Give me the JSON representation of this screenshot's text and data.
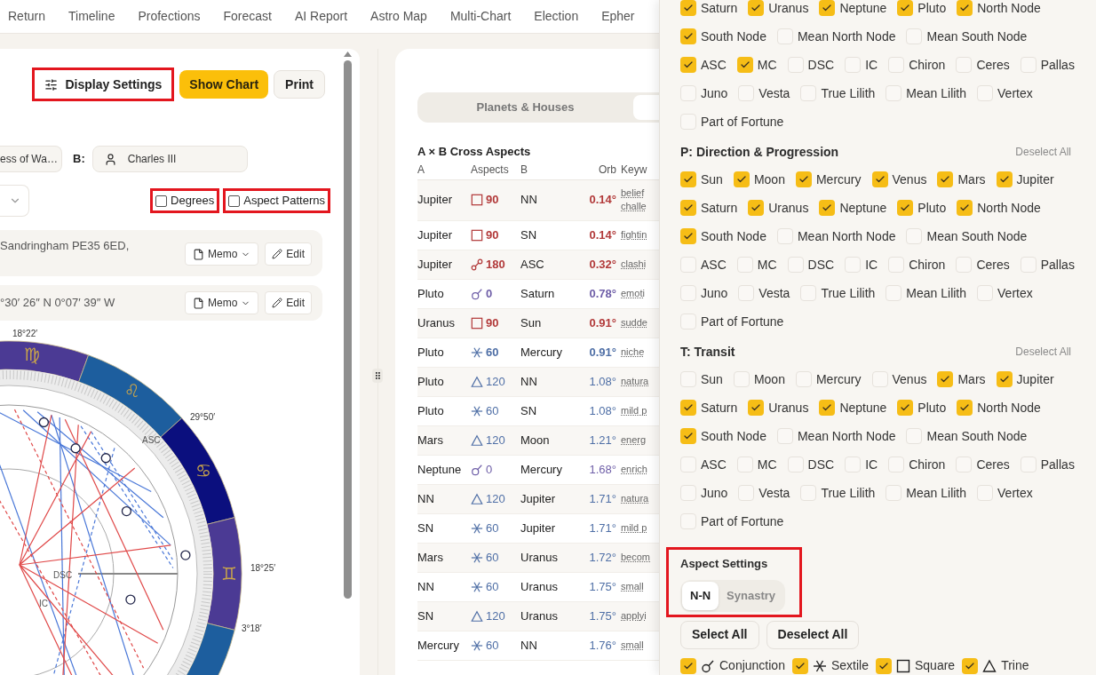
{
  "nav": {
    "tabs": [
      {
        "label": "Return"
      },
      {
        "label": "Timeline"
      },
      {
        "label": "Profections"
      },
      {
        "label": "Forecast"
      },
      {
        "label": "AI Report"
      },
      {
        "label": "Astro Map"
      },
      {
        "label": "Multi-Chart"
      },
      {
        "label": "Election"
      },
      {
        "label": "Epher"
      }
    ]
  },
  "toolbar": {
    "display_settings": {
      "label": "Display Settings",
      "highlighted": true
    },
    "show_chart": "Show Chart",
    "print": "Print"
  },
  "persons": {
    "a_value": "ess of Wa…",
    "b_label": "B:",
    "b_value": "Charles III"
  },
  "options": [
    {
      "label": "Degrees",
      "checked": false,
      "highlighted": true
    },
    {
      "label": "Aspect Patterns",
      "checked": false,
      "highlighted": true
    }
  ],
  "locations": [
    {
      "text": "Sandringham PE35 6ED,",
      "memo": "Memo",
      "edit": "Edit"
    },
    {
      "text": "°30′ 26″ N 0°07′ 39″ W",
      "memo": "Memo",
      "edit": "Edit"
    }
  ],
  "wheel": {
    "signs": [
      {
        "glyph": "♍",
        "color": "#4b3a94"
      },
      {
        "glyph": "♌",
        "color": "#1d5e9e"
      },
      {
        "glyph": "♋",
        "color": "#0b0f7e"
      },
      {
        "glyph": "♊",
        "color": "#4b3a94"
      },
      {
        "color": "#1d5e9e"
      }
    ],
    "degree_labels": [
      "18°22′",
      "29°50′",
      "18°25′",
      "3°18′"
    ],
    "angle_labels": [
      "ASC",
      "DSC",
      "IC"
    ]
  },
  "tabs": [
    {
      "label": "Planets & Houses",
      "selected": false
    },
    {
      "selected": true
    }
  ],
  "cross_aspects": {
    "title": "A × B Cross Aspects",
    "columns": [
      "A",
      "Aspects",
      "B",
      "Orb",
      "Keyw"
    ],
    "rows": [
      {
        "a": "Jupiter",
        "kind": "square",
        "angle": "90",
        "b": "NN",
        "orb": "0.14°",
        "tight": true,
        "keywords": [
          "belief",
          "challe"
        ]
      },
      {
        "a": "Jupiter",
        "kind": "square",
        "angle": "90",
        "b": "SN",
        "orb": "0.14°",
        "tight": true,
        "keywords": [
          "fightin"
        ]
      },
      {
        "a": "Jupiter",
        "kind": "opposition",
        "angle": "180",
        "b": "ASC",
        "orb": "0.32°",
        "tight": true,
        "keywords": [
          "clashi"
        ]
      },
      {
        "a": "Pluto",
        "kind": "conjunction",
        "angle": "0",
        "b": "Saturn",
        "orb": "0.78°",
        "tight": true,
        "keywords": [
          "emoti"
        ]
      },
      {
        "a": "Uranus",
        "kind": "square",
        "angle": "90",
        "b": "Sun",
        "orb": "0.91°",
        "tight": true,
        "keywords": [
          "sudde"
        ]
      },
      {
        "a": "Pluto",
        "kind": "sextile",
        "angle": "60",
        "b": "Mercury",
        "orb": "0.91°",
        "tight": true,
        "keywords": [
          "niche"
        ]
      },
      {
        "a": "Pluto",
        "kind": "trine",
        "angle": "120",
        "b": "NN",
        "orb": "1.08°",
        "tight": false,
        "keywords": [
          "natura"
        ]
      },
      {
        "a": "Pluto",
        "kind": "sextile",
        "angle": "60",
        "b": "SN",
        "orb": "1.08°",
        "tight": false,
        "keywords": [
          "mild p"
        ]
      },
      {
        "a": "Mars",
        "kind": "trine",
        "angle": "120",
        "b": "Moon",
        "orb": "1.21°",
        "tight": false,
        "keywords": [
          "energ"
        ]
      },
      {
        "a": "Neptune",
        "kind": "conjunction",
        "angle": "0",
        "b": "Mercury",
        "orb": "1.68°",
        "tight": false,
        "keywords": [
          "enrich"
        ]
      },
      {
        "a": "NN",
        "kind": "trine",
        "angle": "120",
        "b": "Jupiter",
        "orb": "1.71°",
        "tight": false,
        "keywords": [
          "natura"
        ]
      },
      {
        "a": "SN",
        "kind": "sextile",
        "angle": "60",
        "b": "Jupiter",
        "orb": "1.71°",
        "tight": false,
        "keywords": [
          "mild p"
        ]
      },
      {
        "a": "Mars",
        "kind": "sextile",
        "angle": "60",
        "b": "Uranus",
        "orb": "1.72°",
        "tight": false,
        "keywords": [
          "becom"
        ]
      },
      {
        "a": "NN",
        "kind": "sextile",
        "angle": "60",
        "b": "Uranus",
        "orb": "1.75°",
        "tight": false,
        "keywords": [
          "small"
        ]
      },
      {
        "a": "SN",
        "kind": "trine",
        "angle": "120",
        "b": "Uranus",
        "orb": "1.75°",
        "tight": false,
        "keywords": [
          "applyi"
        ]
      },
      {
        "a": "Mercury",
        "kind": "sextile",
        "angle": "60",
        "b": "NN",
        "orb": "1.76°",
        "tight": false,
        "keywords": [
          "small"
        ]
      }
    ]
  },
  "panel": {
    "sections": [
      {
        "items": [
          {
            "label": "Saturn",
            "checked": true
          },
          {
            "label": "Uranus",
            "checked": true
          },
          {
            "label": "Neptune",
            "checked": true
          },
          {
            "label": "Pluto",
            "checked": true
          },
          {
            "label": "North Node",
            "checked": true
          },
          {
            "label": "South Node",
            "checked": true
          },
          {
            "label": "Mean North Node",
            "checked": false
          },
          {
            "label": "Mean South Node",
            "checked": false
          },
          {
            "label": "ASC",
            "checked": true
          },
          {
            "label": "MC",
            "checked": true
          },
          {
            "label": "DSC",
            "checked": false
          },
          {
            "label": "IC",
            "checked": false
          },
          {
            "label": "Chiron",
            "checked": false
          },
          {
            "label": "Ceres",
            "checked": false
          },
          {
            "label": "Pallas",
            "checked": false
          },
          {
            "label": "Juno",
            "checked": false
          },
          {
            "label": "Vesta",
            "checked": false
          },
          {
            "label": "True Lilith",
            "checked": false
          },
          {
            "label": "Mean Lilith",
            "checked": false
          },
          {
            "label": "Vertex",
            "checked": false
          },
          {
            "label": "Part of Fortune",
            "checked": false
          }
        ]
      },
      {
        "title": "P: Direction & Progression",
        "action": "Deselect All",
        "items": [
          {
            "label": "Sun",
            "checked": true
          },
          {
            "label": "Moon",
            "checked": true
          },
          {
            "label": "Mercury",
            "checked": true
          },
          {
            "label": "Venus",
            "checked": true
          },
          {
            "label": "Mars",
            "checked": true
          },
          {
            "label": "Jupiter",
            "checked": true
          },
          {
            "label": "Saturn",
            "checked": true
          },
          {
            "label": "Uranus",
            "checked": true
          },
          {
            "label": "Neptune",
            "checked": true
          },
          {
            "label": "Pluto",
            "checked": true
          },
          {
            "label": "North Node",
            "checked": true
          },
          {
            "label": "South Node",
            "checked": true
          },
          {
            "label": "Mean North Node",
            "checked": false
          },
          {
            "label": "Mean South Node",
            "checked": false
          },
          {
            "label": "ASC",
            "checked": false
          },
          {
            "label": "MC",
            "checked": false
          },
          {
            "label": "DSC",
            "checked": false
          },
          {
            "label": "IC",
            "checked": false
          },
          {
            "label": "Chiron",
            "checked": false
          },
          {
            "label": "Ceres",
            "checked": false
          },
          {
            "label": "Pallas",
            "checked": false
          },
          {
            "label": "Juno",
            "checked": false
          },
          {
            "label": "Vesta",
            "checked": false
          },
          {
            "label": "True Lilith",
            "checked": false
          },
          {
            "label": "Mean Lilith",
            "checked": false
          },
          {
            "label": "Vertex",
            "checked": false
          },
          {
            "label": "Part of Fortune",
            "checked": false
          }
        ]
      },
      {
        "title": "T: Transit",
        "action": "Deselect All",
        "items": [
          {
            "label": "Sun",
            "checked": false
          },
          {
            "label": "Moon",
            "checked": false
          },
          {
            "label": "Mercury",
            "checked": false
          },
          {
            "label": "Venus",
            "checked": false
          },
          {
            "label": "Mars",
            "checked": true
          },
          {
            "label": "Jupiter",
            "checked": true
          },
          {
            "label": "Saturn",
            "checked": true
          },
          {
            "label": "Uranus",
            "checked": true
          },
          {
            "label": "Neptune",
            "checked": true
          },
          {
            "label": "Pluto",
            "checked": true
          },
          {
            "label": "North Node",
            "checked": true
          },
          {
            "label": "South Node",
            "checked": true
          },
          {
            "label": "Mean North Node",
            "checked": false
          },
          {
            "label": "Mean South Node",
            "checked": false
          },
          {
            "label": "ASC",
            "checked": false
          },
          {
            "label": "MC",
            "checked": false
          },
          {
            "label": "DSC",
            "checked": false
          },
          {
            "label": "IC",
            "checked": false
          },
          {
            "label": "Chiron",
            "checked": false
          },
          {
            "label": "Ceres",
            "checked": false
          },
          {
            "label": "Pallas",
            "checked": false
          },
          {
            "label": "Juno",
            "checked": false
          },
          {
            "label": "Vesta",
            "checked": false
          },
          {
            "label": "True Lilith",
            "checked": false
          },
          {
            "label": "Mean Lilith",
            "checked": false
          },
          {
            "label": "Vertex",
            "checked": false
          },
          {
            "label": "Part of Fortune",
            "checked": false
          }
        ]
      }
    ],
    "aspect_settings": {
      "title": "Aspect Settings",
      "highlighted": true,
      "modes": [
        {
          "label": "N-N",
          "selected": true
        },
        {
          "label": "Synastry",
          "selected": false
        }
      ],
      "buttons": [
        "Select All",
        "Deselect All"
      ],
      "aspects": [
        {
          "kind": "conjunction",
          "label": "Conjunction",
          "checked": true
        },
        {
          "kind": "sextile",
          "label": "Sextile",
          "checked": true
        },
        {
          "kind": "square",
          "label": "Square",
          "checked": true
        },
        {
          "kind": "trine",
          "label": "Trine",
          "checked": true
        }
      ]
    }
  }
}
